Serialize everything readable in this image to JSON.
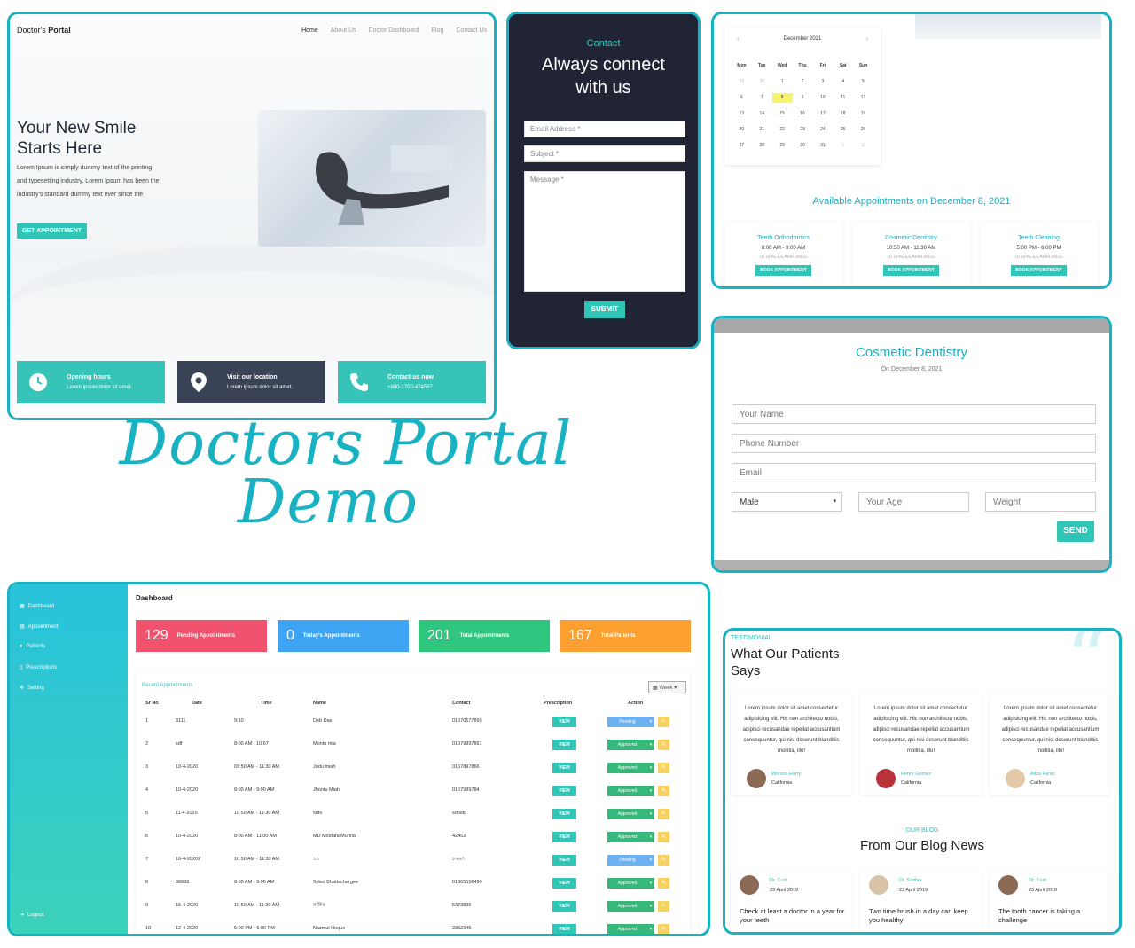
{
  "hero": {
    "logo_plain": "Doctor's ",
    "logo_bold": "Portal",
    "nav": [
      "Home",
      "About Us",
      "Doctor Dashboard",
      "Blog",
      "Contact Us"
    ],
    "title_line1": "Your New Smile",
    "title_line2": "Starts Here",
    "text": "Lorem Ipsum is simply dummy text of the printing and typesetting industry. Lorem Ipsum has been the industry's standard dummy text ever since the",
    "button": "GET APPOINTMENT",
    "cards": [
      {
        "title": "Opening hours",
        "sub": "Lorem ipsum dolor sit amet.",
        "color": "#37c4b8",
        "icon": "clock-icon"
      },
      {
        "title": "Visit our location",
        "sub": "Lorem ipsum dolor sit amet.",
        "color": "#3a4256",
        "icon": "location-pin-icon"
      },
      {
        "title": "Contact us now",
        "sub": "+880-1700-474567",
        "color": "#37c4b8",
        "icon": "phone-icon"
      }
    ]
  },
  "contact": {
    "subtitle": "Contact",
    "title_line1": "Always connect",
    "title_line2": "with us",
    "email_placeholder": "Email Address *",
    "subject_placeholder": "Subject *",
    "message_placeholder": "Message *",
    "submit": "SUBMIT"
  },
  "calendar": {
    "month": "December 2021",
    "weekdays": [
      "Mon",
      "Tue",
      "Wed",
      "Thu",
      "Fri",
      "Sat",
      "Sun"
    ],
    "days": [
      "29",
      "30",
      "1",
      "2",
      "3",
      "4",
      "5",
      "6",
      "7",
      "8",
      "9",
      "10",
      "11",
      "12",
      "13",
      "14",
      "15",
      "16",
      "17",
      "18",
      "19",
      "20",
      "21",
      "22",
      "23",
      "24",
      "25",
      "26",
      "27",
      "28",
      "29",
      "30",
      "31",
      "1",
      "2"
    ],
    "selected_day": "8",
    "available_title": "Available Appointments on December 8, 2021",
    "services": [
      {
        "name": "Teeth Orthodontics",
        "time": "8:00 AM - 9:00 AM",
        "spaces": "10 SPACES AVAILABLE",
        "button": "BOOK APPOINTMENT"
      },
      {
        "name": "Cosmetic Dentistry",
        "time": "10:50 AM - 11:30 AM",
        "spaces": "10 SPACES AVAILABLE",
        "button": "BOOK APPOINTMENT"
      },
      {
        "name": "Teeth Cleaning",
        "time": "5:00 PM - 6:00 PM",
        "spaces": "10 SPACES AVAILABLE",
        "button": "BOOK APPOINTMENT"
      }
    ]
  },
  "form": {
    "title": "Cosmetic Dentistry",
    "date": "On December 8, 2021",
    "name_placeholder": "Your Name",
    "phone_placeholder": "Phone Number",
    "email_placeholder": "Email",
    "gender_value": "Male",
    "age_placeholder": "Your Age",
    "weight_placeholder": "Weight",
    "send": "SEND"
  },
  "demo_title": {
    "line1": "Doctors Portal",
    "line2": "Demo"
  },
  "dashboard": {
    "title": "Dashboard",
    "sidebar": [
      "Dashboard",
      "Appointment",
      "Patients",
      "Prescriptions",
      "Setting"
    ],
    "logout": "Logout",
    "stats": [
      {
        "value": "129",
        "label": "Pending Appointments",
        "color": "#f1536e"
      },
      {
        "value": "0",
        "label": "Today's Appointments",
        "color": "#3da5f4"
      },
      {
        "value": "201",
        "label": "Total Appointments",
        "color": "#2fc67f"
      },
      {
        "value": "167",
        "label": "Total Patients",
        "color": "#fda02f"
      }
    ],
    "recent_title": "Recent Appointments",
    "filter": "Week",
    "columns": [
      "Sr No",
      "Date",
      "Time",
      "Name",
      "Contact",
      "Prescription",
      "Action"
    ],
    "rows": [
      {
        "sr": "1",
        "date": "3111",
        "time": "9:10",
        "name": "Deb Das",
        "contact": "01670677899",
        "status": "Pending"
      },
      {
        "sr": "2",
        "date": "sdf",
        "time": "8:00 AM - 10:67",
        "name": "Montu mia",
        "contact": "01679897861",
        "status": "Approved"
      },
      {
        "sr": "3",
        "date": "10-4-2020",
        "time": "09:50 AM - 11:30 AM",
        "name": "Jodu miah",
        "contact": "0167897866",
        "status": "Approved"
      },
      {
        "sr": "4",
        "date": "10-4-2020",
        "time": "8:00 AM - 9:00 AM",
        "name": "Jhontu Miah",
        "contact": "0167989784",
        "status": "Approved"
      },
      {
        "sr": "5",
        "date": "11-4-2020",
        "time": "10:50 AM - 11:30 AM",
        "name": "sdfs",
        "contact": "sdfsdc",
        "status": "Approved"
      },
      {
        "sr": "6",
        "date": "10-4-2020",
        "time": "8:00 AM - 11:00 AM",
        "name": "MD Mostafa Munna",
        "contact": "42452",
        "status": "Approved"
      },
      {
        "sr": "7",
        "date": "16-4-20202",
        "time": "10:50 AM - 11:30 AM",
        "name": "১১",
        "contact": "৮৬৬৭",
        "status": "Pending"
      },
      {
        "sr": "8",
        "date": "88888",
        "time": "8:00 AM - 9:00 AM",
        "name": "Syket Bhattachergee",
        "contact": "01865556490",
        "status": "Approved"
      },
      {
        "sr": "9",
        "date": "15-4-2020",
        "time": "10:50 AM - 11:30 AM",
        "name": "সাকিব",
        "contact": "5373836",
        "status": "Approved"
      },
      {
        "sr": "10",
        "date": "12-4-2020",
        "time": "5:00 PM - 6:00 PM",
        "name": "Nazmul Hoque",
        "contact": "2352345",
        "status": "Approved"
      }
    ],
    "view_label": "VIEW",
    "status_colors": {
      "Pending": "#6cb2f2",
      "Approved": "#35b87a"
    }
  },
  "testimonial": {
    "tag": "TESTIMONIAL",
    "title_line1": "What Our Patients",
    "title_line2": "Says",
    "text": "Lorem ipsum dolor sit amet consectetur adipisicing elit. Hic non architecto nobis, adipisci recusandae repellat accusantium consequuntur, qui nisi deserunt blanditiis mollitia, illo!",
    "people": [
      {
        "name": "Winson Harry",
        "location": "California"
      },
      {
        "name": "Henry Gomez",
        "location": "California"
      },
      {
        "name": "Aliza Farari",
        "location": "California"
      }
    ]
  },
  "blog": {
    "tag": "OUR BLOG",
    "title": "From Our Blog News",
    "posts": [
      {
        "author": "Dr. Cudi",
        "date": "23 April 2019",
        "title": "Check at least a doctor in a year for your teeth"
      },
      {
        "author": "Dr. Sinthia",
        "date": "23 April 2019",
        "title": "Two time brush in a day can keep you healthy"
      },
      {
        "author": "Dr. Cudi",
        "date": "23 April 2019",
        "title": "The tooth cancer is taking a challenge"
      }
    ]
  }
}
